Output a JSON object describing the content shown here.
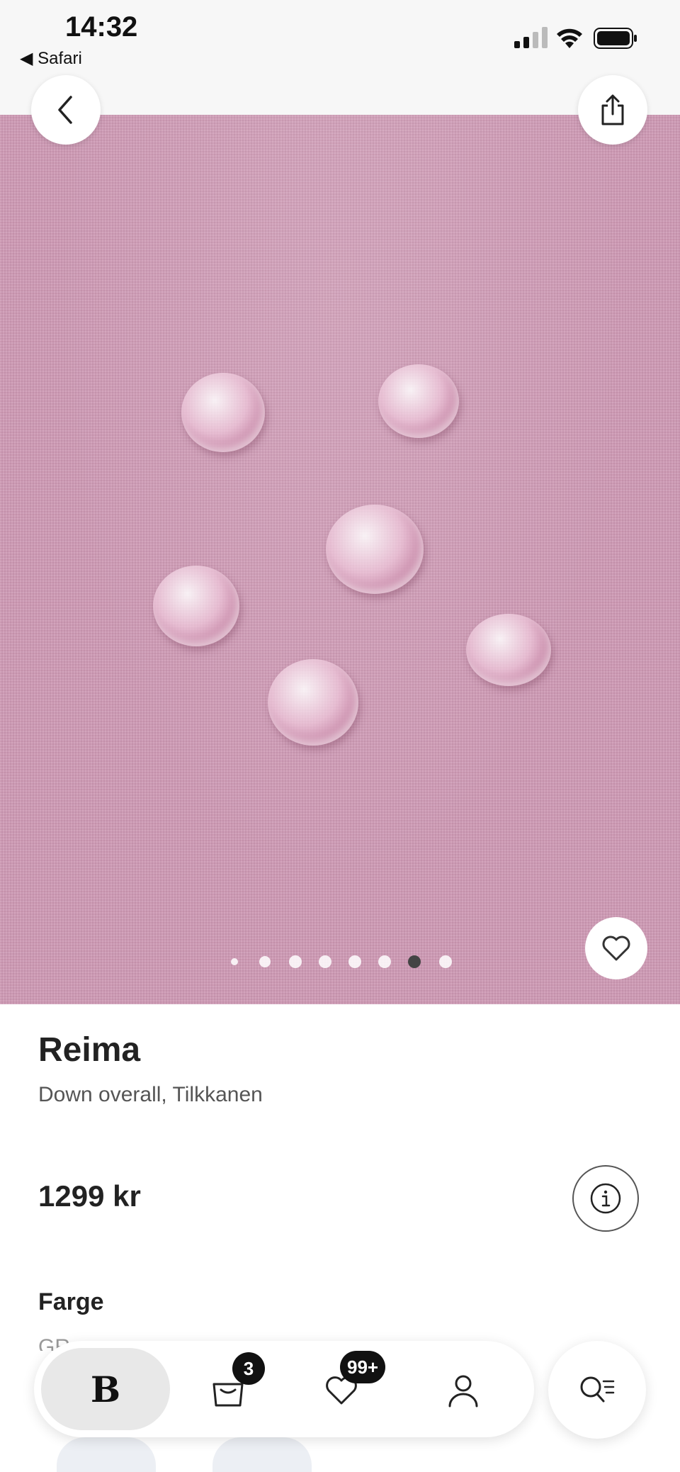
{
  "status": {
    "time": "14:32",
    "back_app": "◀ Safari"
  },
  "header": {
    "back_icon": "chevron-left-icon",
    "share_icon": "share-icon"
  },
  "gallery": {
    "image_description_icon": "fabric-water-drops",
    "dot_count": 8,
    "active_index": 6
  },
  "product": {
    "brand": "Reima",
    "name": "Down overall, Tilkkanen",
    "price": "1299 kr",
    "color_label": "Farge",
    "color_value": "GR"
  },
  "nav": {
    "home_logo": "B",
    "cart_badge": "3",
    "favorites_badge": "99+"
  },
  "colors": {
    "hero_pink": "#cf9ab5",
    "badge_bg": "#111111",
    "nav_active_bg": "#e8e8e8"
  }
}
